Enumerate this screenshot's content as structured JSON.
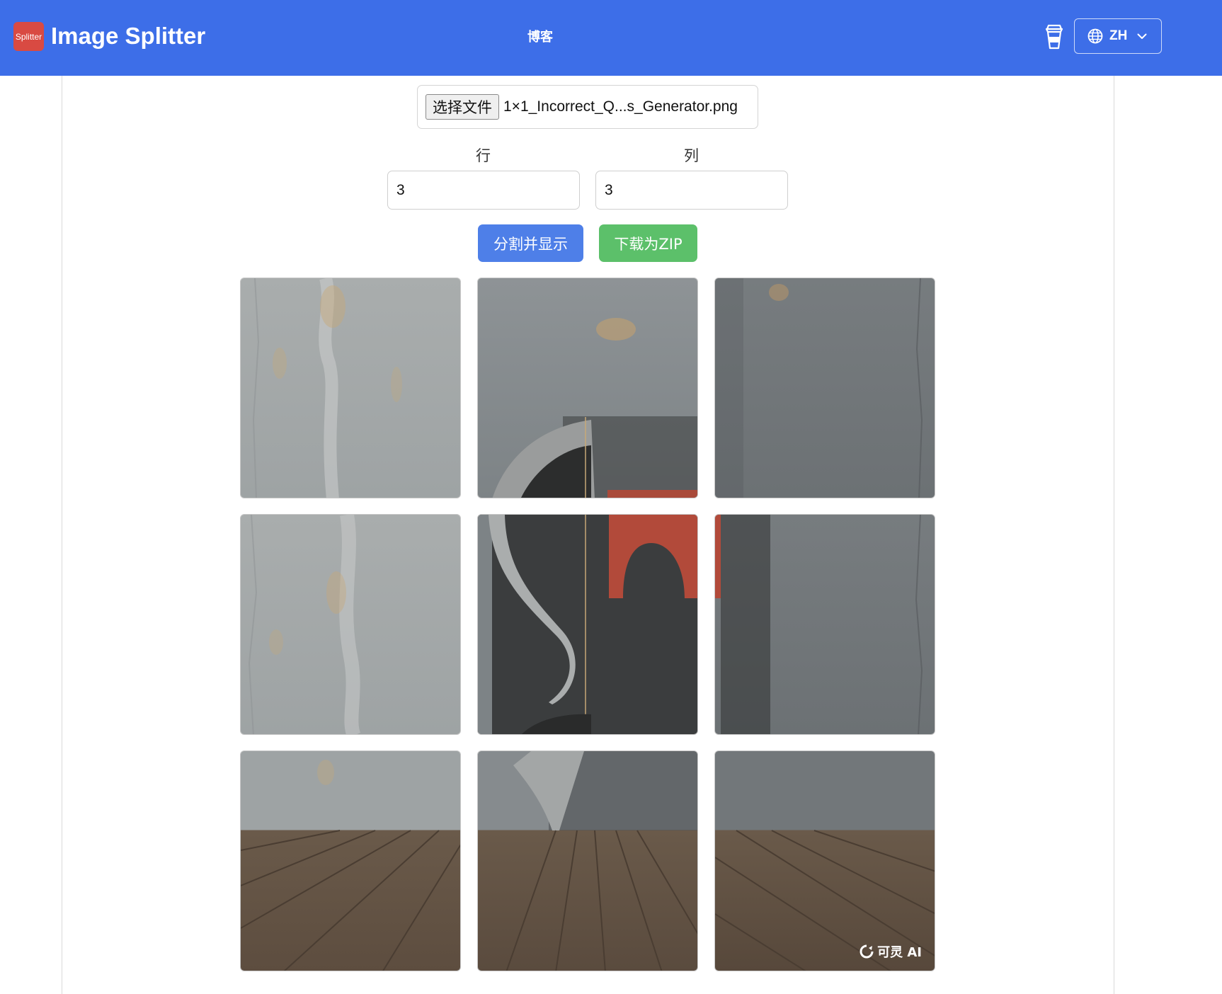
{
  "header": {
    "logo_text": "Splitter",
    "brand": "Image Splitter",
    "nav_blog": "博客",
    "lang_code": "ZH",
    "bg_color": "#3d6ee8"
  },
  "upload": {
    "choose_file_label": "选择文件",
    "file_name": "1×1_Incorrect_Q...s_Generator.png"
  },
  "grid_settings": {
    "rows_label": "行",
    "rows_value": "3",
    "cols_label": "列",
    "cols_value": "3"
  },
  "actions": {
    "split_label": "分割并显示",
    "zip_label": "下载为ZIP",
    "split_color": "#4e7fe8",
    "zip_color": "#5cc06a"
  },
  "tiles": {
    "watermark": "可灵 AI"
  }
}
